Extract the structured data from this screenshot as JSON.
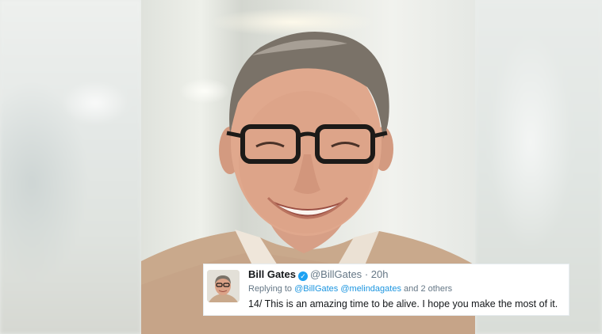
{
  "tweet": {
    "display_name": "Bill Gates",
    "handle": "@BillGates",
    "separator": "·",
    "time": "20h",
    "reply_prefix": "Replying to",
    "reply_mention_1": "@BillGates",
    "reply_mention_2": "@melindagates",
    "reply_suffix": "and 2 others",
    "text": "14/ This is an amazing time to be alive. I hope you make the most of it.",
    "verified_icon": "✓"
  },
  "colors": {
    "link": "#1b95e0",
    "muted": "#657786",
    "verified": "#1da1f2"
  }
}
